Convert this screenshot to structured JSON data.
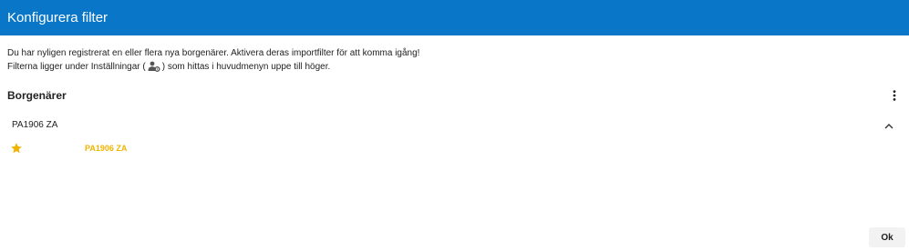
{
  "dialog": {
    "title": "Konfigurera filter"
  },
  "info": {
    "line1": "Du har nyligen registrerat en eller flera nya borgenärer. Aktivera deras importfilter för att komma igång!",
    "line2_prefix": "Filterna ligger under Inställningar (",
    "line2_icon": "user-settings-icon",
    "line2_suffix": ") som hittas i huvudmenyn uppe till höger."
  },
  "section": {
    "title": "Borgenärer",
    "menu_icon": "more-vert-icon"
  },
  "groups": [
    {
      "label": "PA1906 ZA",
      "expanded": true,
      "items": [
        {
          "label": "PA1906 ZA",
          "icon": "star-icon",
          "favorite": true
        }
      ]
    }
  ],
  "footer": {
    "ok_label": "Ok"
  },
  "colors": {
    "header_bg": "#0a76c8",
    "accent_yellow": "#f0b400"
  }
}
